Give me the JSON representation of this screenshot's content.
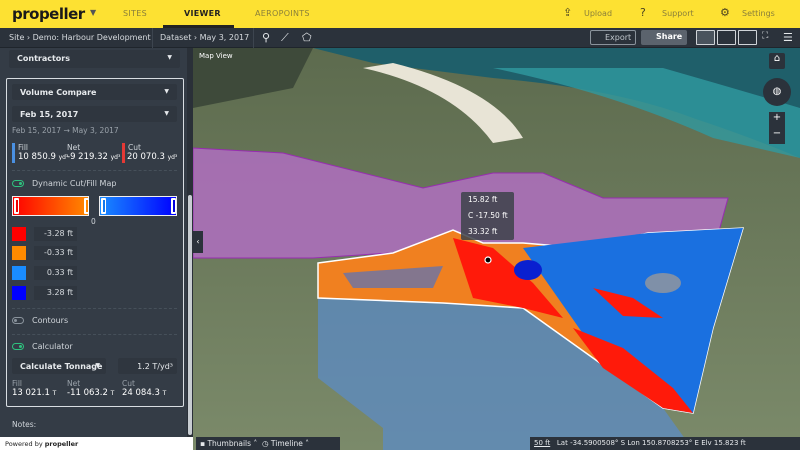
{
  "header": {
    "logo": "propeller",
    "tabs": [
      {
        "label": "SITES"
      },
      {
        "label": "VIEWER",
        "active": true
      },
      {
        "label": "AEROPOINTS"
      }
    ],
    "actions": [
      {
        "label": "Upload",
        "icon": "upload-icon"
      },
      {
        "label": "Support",
        "icon": "help-icon"
      },
      {
        "label": "Settings",
        "icon": "gear-icon"
      }
    ]
  },
  "subbar": {
    "site": "Site › Demo: Harbour Development",
    "dataset": "Dataset › May 3, 2017",
    "tools": [
      "pin-icon",
      "polyline-icon",
      "polygon-icon"
    ],
    "export": "Export",
    "share": "Share"
  },
  "sidebar": {
    "contractors": "Contractors",
    "mode": "Volume Compare",
    "date": "Feb 15, 2017",
    "range": "Feb 15, 2017 → May 3, 2017",
    "volumes": {
      "fill_label": "Fill",
      "fill_value": "10 850.9",
      "net_label": "Net",
      "net_value": "-9 219.32",
      "cut_label": "Cut",
      "cut_value": "20 070.3",
      "unit": "yd³"
    },
    "cutfill_map": "Dynamic Cut/Fill Map",
    "zero": "0",
    "legend": [
      {
        "color": "#ff0000",
        "value": "-3.28 ft"
      },
      {
        "color": "#ff8a00",
        "value": "-0.33 ft"
      },
      {
        "color": "#1a8cff",
        "value": "0.33 ft"
      },
      {
        "color": "#0000ff",
        "value": "3.28 ft"
      }
    ],
    "contours": "Contours",
    "calculator": "Calculator",
    "calc_mode": "Calculate Tonnage",
    "density": "1.2 T/yd³",
    "tonnage": {
      "fill_label": "Fill",
      "fill_value": "13 021.1",
      "net_label": "Net",
      "net_value": "-11 063.2",
      "cut_label": "Cut",
      "cut_value": "24 084.3",
      "unit": "T"
    },
    "notes": "Notes:",
    "footer": "Powered by",
    "footer_logo": "propeller"
  },
  "map": {
    "label": "Map View",
    "tooltip": [
      "15.82 ft",
      "C -17.50 ft",
      "33.32 ft"
    ],
    "thumbnails": "Thumbnails",
    "timeline": "Timeline",
    "scale": "50 ft",
    "lat": "Lat -34.5900508° S",
    "lon": "Lon 150.8708253° E",
    "elv": "Elv 15.823 ft"
  },
  "colors": {
    "brand": "#fde132",
    "toggle_on": "#2ec27e"
  }
}
